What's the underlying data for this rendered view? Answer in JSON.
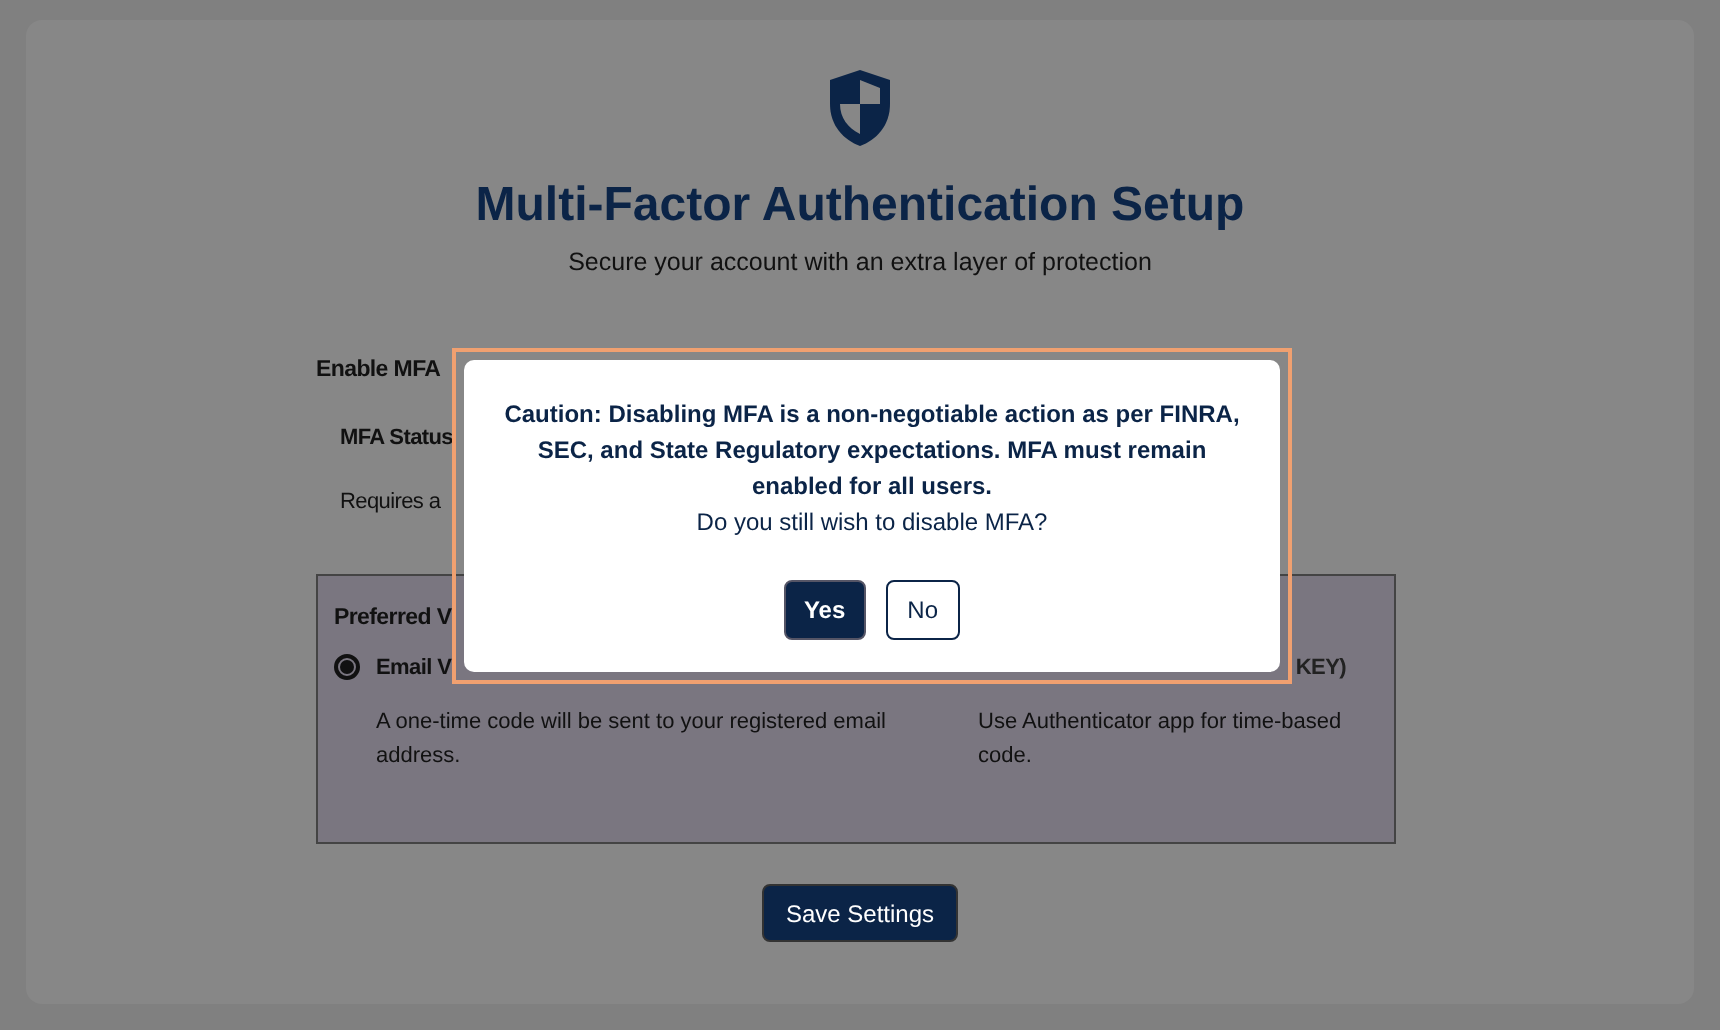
{
  "header": {
    "title": "Multi-Factor Authentication Setup",
    "subtitle": "Secure your account with an extra layer of protection"
  },
  "enable_label": "Enable MFA",
  "status_label": "MFA Status",
  "requires_text": "Requires a",
  "preferred": {
    "heading": "Preferred V",
    "options": [
      {
        "label": "Email V",
        "description": "A one-time code will be sent to your registered email address.",
        "selected": true
      },
      {
        "label": "KEY)",
        "description": "Use Authenticator app for time-based code.",
        "selected": false
      }
    ]
  },
  "save_button": "Save Settings",
  "dialog": {
    "warning": "Caution: Disabling MFA is a non-negotiable action as per FINRA, SEC, and State Regulatory expectations. MFA must remain enabled for all users.",
    "question": "Do you still wish to disable MFA?",
    "buttons": [
      {
        "label": "Yes",
        "kind": "primary"
      },
      {
        "label": "No",
        "kind": "secondary"
      }
    ]
  }
}
